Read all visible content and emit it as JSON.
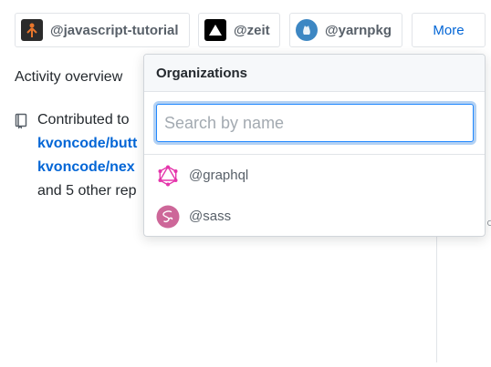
{
  "org_filters": [
    {
      "label": "@javascript-tutorial",
      "icon": "javascript-tutorial-logo-icon"
    },
    {
      "label": "@zeit",
      "icon": "zeit-triangle-logo-icon"
    },
    {
      "label": "@yarnpkg",
      "icon": "yarn-cat-logo-icon"
    }
  ],
  "more_label": "More",
  "activity": {
    "title": "Activity overview",
    "lines": [
      "Contributed to ",
      "kvoncode/butt",
      "kvoncode/nex",
      "and 5 other rep"
    ]
  },
  "dropdown": {
    "header": "Organizations",
    "search_placeholder": "Search by name",
    "search_value": "",
    "items": [
      {
        "label": "@graphql",
        "icon": "graphql-logo-icon",
        "color": "#e535ab"
      },
      {
        "label": "@sass",
        "icon": "sass-logo-icon",
        "color": "#cd6799"
      }
    ]
  },
  "colors": {
    "link": "#0366d6",
    "focus_ring": "#2188ff"
  }
}
